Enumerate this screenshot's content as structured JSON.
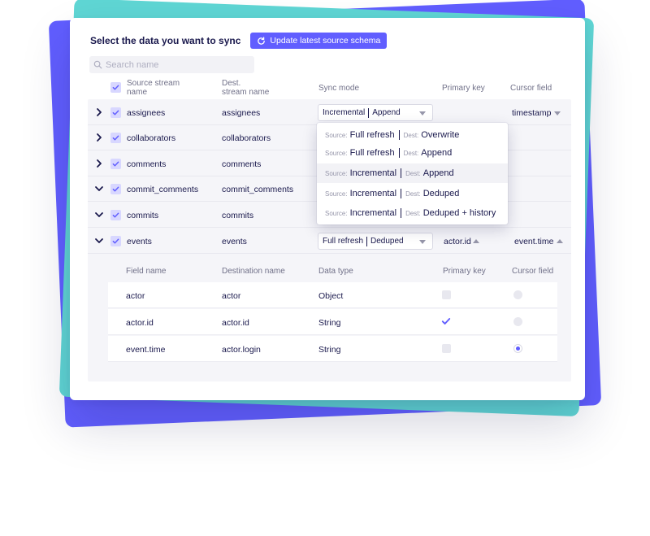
{
  "header": {
    "title": "Select the data you want to sync",
    "update_label": "Update latest source schema"
  },
  "search": {
    "placeholder": "Search name"
  },
  "columns": {
    "source_1": "Source stream",
    "source_2": "name",
    "dest_1": "Dest.",
    "dest_2": "stream name",
    "sync_mode": "Sync mode",
    "primary_key": "Primary key",
    "cursor_field": "Cursor field"
  },
  "streams": [
    {
      "source": "assignees",
      "dest": "assignees",
      "expanded": false,
      "sync_mode_source": "Incremental",
      "sync_mode_dest": "Append",
      "cursor": "timestamp"
    },
    {
      "source": "collaborators",
      "dest": "collaborators",
      "expanded": false
    },
    {
      "source": "comments",
      "dest": "comments",
      "expanded": false
    },
    {
      "source": "commit_comments",
      "dest": "commit_comments",
      "expanded": true
    },
    {
      "source": "commits",
      "dest": "commits",
      "expanded": true
    },
    {
      "source": "events",
      "dest": "events",
      "expanded": true,
      "sync_mode_source": "Full refresh",
      "sync_mode_dest": "Deduped",
      "primary_key": "actor.id",
      "cursor": "event.time"
    }
  ],
  "dropdown": {
    "source_label": "Source:",
    "dest_label": "Dest:",
    "options": [
      {
        "source": "Full refresh",
        "dest": "Overwrite",
        "selected": false
      },
      {
        "source": "Full refresh",
        "dest": "Append",
        "selected": false
      },
      {
        "source": "Incremental",
        "dest": "Append",
        "selected": true
      },
      {
        "source": "Incremental",
        "dest": "Deduped",
        "selected": false
      },
      {
        "source": "Incremental",
        "dest": "Deduped + history",
        "selected": false
      }
    ]
  },
  "fields": {
    "headers": {
      "field_name": "Field name",
      "dest_name": "Destination name",
      "data_type": "Data type",
      "primary_key": "Primary key",
      "cursor_field": "Cursor field"
    },
    "rows": [
      {
        "name": "actor",
        "dest": "actor",
        "type": "Object",
        "pk": false,
        "cursor": false
      },
      {
        "name": "actor.id",
        "dest": "actor.id",
        "type": "String",
        "pk": true,
        "cursor": false
      },
      {
        "name": "event.time",
        "dest": "actor.login",
        "type": "String",
        "pk": false,
        "cursor": true
      }
    ]
  },
  "colors": {
    "accent": "#615eff",
    "teal": "#5fd6d4",
    "text": "#1a194d",
    "muted": "#717189"
  }
}
